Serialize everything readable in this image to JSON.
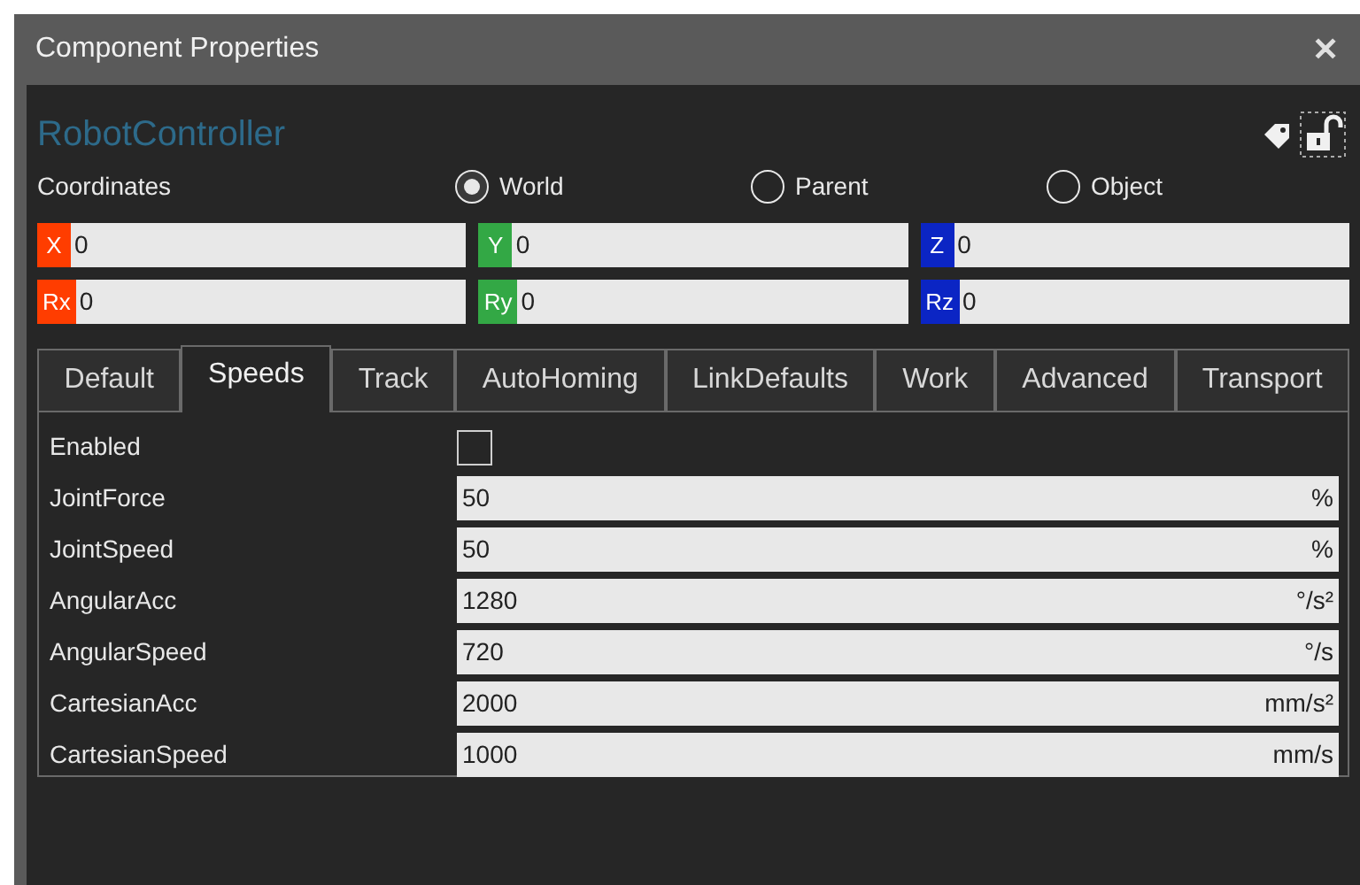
{
  "window": {
    "title": "Component Properties",
    "close": "✕"
  },
  "component": {
    "name": "RobotController"
  },
  "coordinates": {
    "label": "Coordinates",
    "options": [
      {
        "label": "World",
        "selected": true
      },
      {
        "label": "Parent",
        "selected": false
      },
      {
        "label": "Object",
        "selected": false
      }
    ]
  },
  "axes": [
    {
      "label": "X",
      "value": "0",
      "color": "#ff3d00"
    },
    {
      "label": "Y",
      "value": "0",
      "color": "#33a845"
    },
    {
      "label": "Z",
      "value": "0",
      "color": "#0b25c4"
    },
    {
      "label": "Rx",
      "value": "0",
      "color": "#ff3d00"
    },
    {
      "label": "Ry",
      "value": "0",
      "color": "#33a845"
    },
    {
      "label": "Rz",
      "value": "0",
      "color": "#0b25c4"
    }
  ],
  "tabs": [
    {
      "label": "Default",
      "selected": false
    },
    {
      "label": "Speeds",
      "selected": true
    },
    {
      "label": "Track",
      "selected": false
    },
    {
      "label": "AutoHoming",
      "selected": false
    },
    {
      "label": "LinkDefaults",
      "selected": false
    },
    {
      "label": "Work",
      "selected": false
    },
    {
      "label": "Advanced",
      "selected": false
    },
    {
      "label": "Transport",
      "selected": false
    }
  ],
  "properties": [
    {
      "kind": "checkbox",
      "label": "Enabled",
      "checked": false
    },
    {
      "kind": "number",
      "label": "JointForce",
      "value": "50",
      "unit": "%"
    },
    {
      "kind": "number",
      "label": "JointSpeed",
      "value": "50",
      "unit": "%"
    },
    {
      "kind": "number",
      "label": "AngularAcc",
      "value": "1280",
      "unit": "°/s²"
    },
    {
      "kind": "number",
      "label": "AngularSpeed",
      "value": "720",
      "unit": "°/s"
    },
    {
      "kind": "number",
      "label": "CartesianAcc",
      "value": "2000",
      "unit": "mm/s²"
    },
    {
      "kind": "number",
      "label": "CartesianSpeed",
      "value": "1000",
      "unit": "mm/s"
    }
  ]
}
